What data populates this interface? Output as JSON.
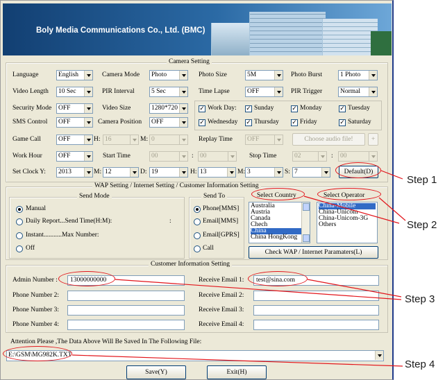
{
  "banner": {
    "company": "Boly Media Communications Co., Ltd. (BMC)"
  },
  "camera": {
    "title": "Camera Setting",
    "language_label": "Language",
    "language": "English",
    "camera_mode_label": "Camera Mode",
    "camera_mode": "Photo",
    "photo_size_label": "Photo Size",
    "photo_size": "5M",
    "photo_burst_label": "Photo Burst",
    "photo_burst": "1 Photo",
    "video_length_label": "Video Length",
    "video_length": "10  Sec",
    "pir_interval_label": "PIR Interval",
    "pir_interval": "5  Sec",
    "time_lapse_label": "Time Lapse",
    "time_lapse": "OFF",
    "pir_trigger_label": "PIR Trigger",
    "pir_trigger": "Normal",
    "security_mode_label": "Security Mode",
    "security_mode": "OFF",
    "video_size_label": "Video Size",
    "video_size": "1280*720",
    "work_day_label": "Work Day:",
    "days": [
      "Sunday",
      "Monday",
      "Tuesday",
      "Wednesday",
      "Thursday",
      "Friday",
      "Saturday"
    ],
    "sms_control_label": "SMS Control",
    "sms_control": "OFF",
    "camera_position_label": "Camera Position",
    "camera_position": "OFF",
    "game_call_label": "Game Call",
    "game_call": "OFF",
    "gc_h_label": "H:",
    "gc_h": "16",
    "gc_m_label": "M:",
    "gc_m": "0",
    "replay_time_label": "Replay Time",
    "replay_time": "OFF",
    "choose_audio": "Choose audio file!",
    "plus": "+",
    "work_hour_label": "Work Hour",
    "work_hour": "OFF",
    "start_time_label": "Start Time",
    "start_h": "00",
    "colon": ":",
    "start_m": "00",
    "stop_time_label": "Stop Time",
    "stop_h": "02",
    "stop_m": "00",
    "set_clock_label": "Set Clock Y:",
    "year": "2013",
    "mon_label": "M:",
    "mon": "12",
    "day_label": "D:",
    "day": "19",
    "hour_label": "H:",
    "hour": "13",
    "min_label": "M:",
    "min": "3",
    "sec_label": "S:",
    "sec": "7",
    "default_btn": "Default(D)"
  },
  "wap": {
    "title": "WAP Setting / Internet Setting / Customer Information Setting",
    "send_mode_title": "Send Mode",
    "manual": "Manual",
    "daily": "Daily Report...Send Time(H:M):",
    "daily_colon": ":",
    "instant": "Instant...........Max Number:",
    "off": "Off",
    "send_to_title": "Send To",
    "phone_mms": "Phone[MMS]",
    "email_mms": "Email[MMS]",
    "email_gprs": "Email[GPRS]",
    "call": "Call",
    "select_country": "Select Country",
    "countries": [
      "Australia",
      "Austria",
      "Canada",
      "Chech",
      "China",
      "China HongKong"
    ],
    "select_operator": "Select Operator",
    "operators": [
      "China-Mobile",
      "China-Unicom",
      "China-Unicom-3G",
      "Others"
    ],
    "check_btn": "Check WAP / Internet Paramaters(L)"
  },
  "cust": {
    "title": "Customer Information Setting",
    "admin_label": "Admin Number :",
    "admin": "13000000000",
    "phone2_label": "Phone Number 2:",
    "phone3_label": "Phone Number 3:",
    "phone4_label": "Phone Number 4:",
    "email1_label": "Receive Email 1:",
    "email1": "test@sina.com",
    "email2_label": "Receive Email 2:",
    "email3_label": "Receive Email 3:",
    "email4_label": "Receive Email 4:"
  },
  "footer": {
    "attention": "Attention Please ,The Data Above Will Be Saved In The Following  File:",
    "path": "E:\\GSM\\MG982K.TXT",
    "save": "Save(Y)",
    "exit": "Exit(H)"
  },
  "steps": [
    "Step 1",
    "Step 2",
    "Step 3",
    "Step 4"
  ],
  "colors": {
    "annotation": "#e2141a",
    "window_bg": "#ece9d8",
    "selection": "#316ac5"
  }
}
